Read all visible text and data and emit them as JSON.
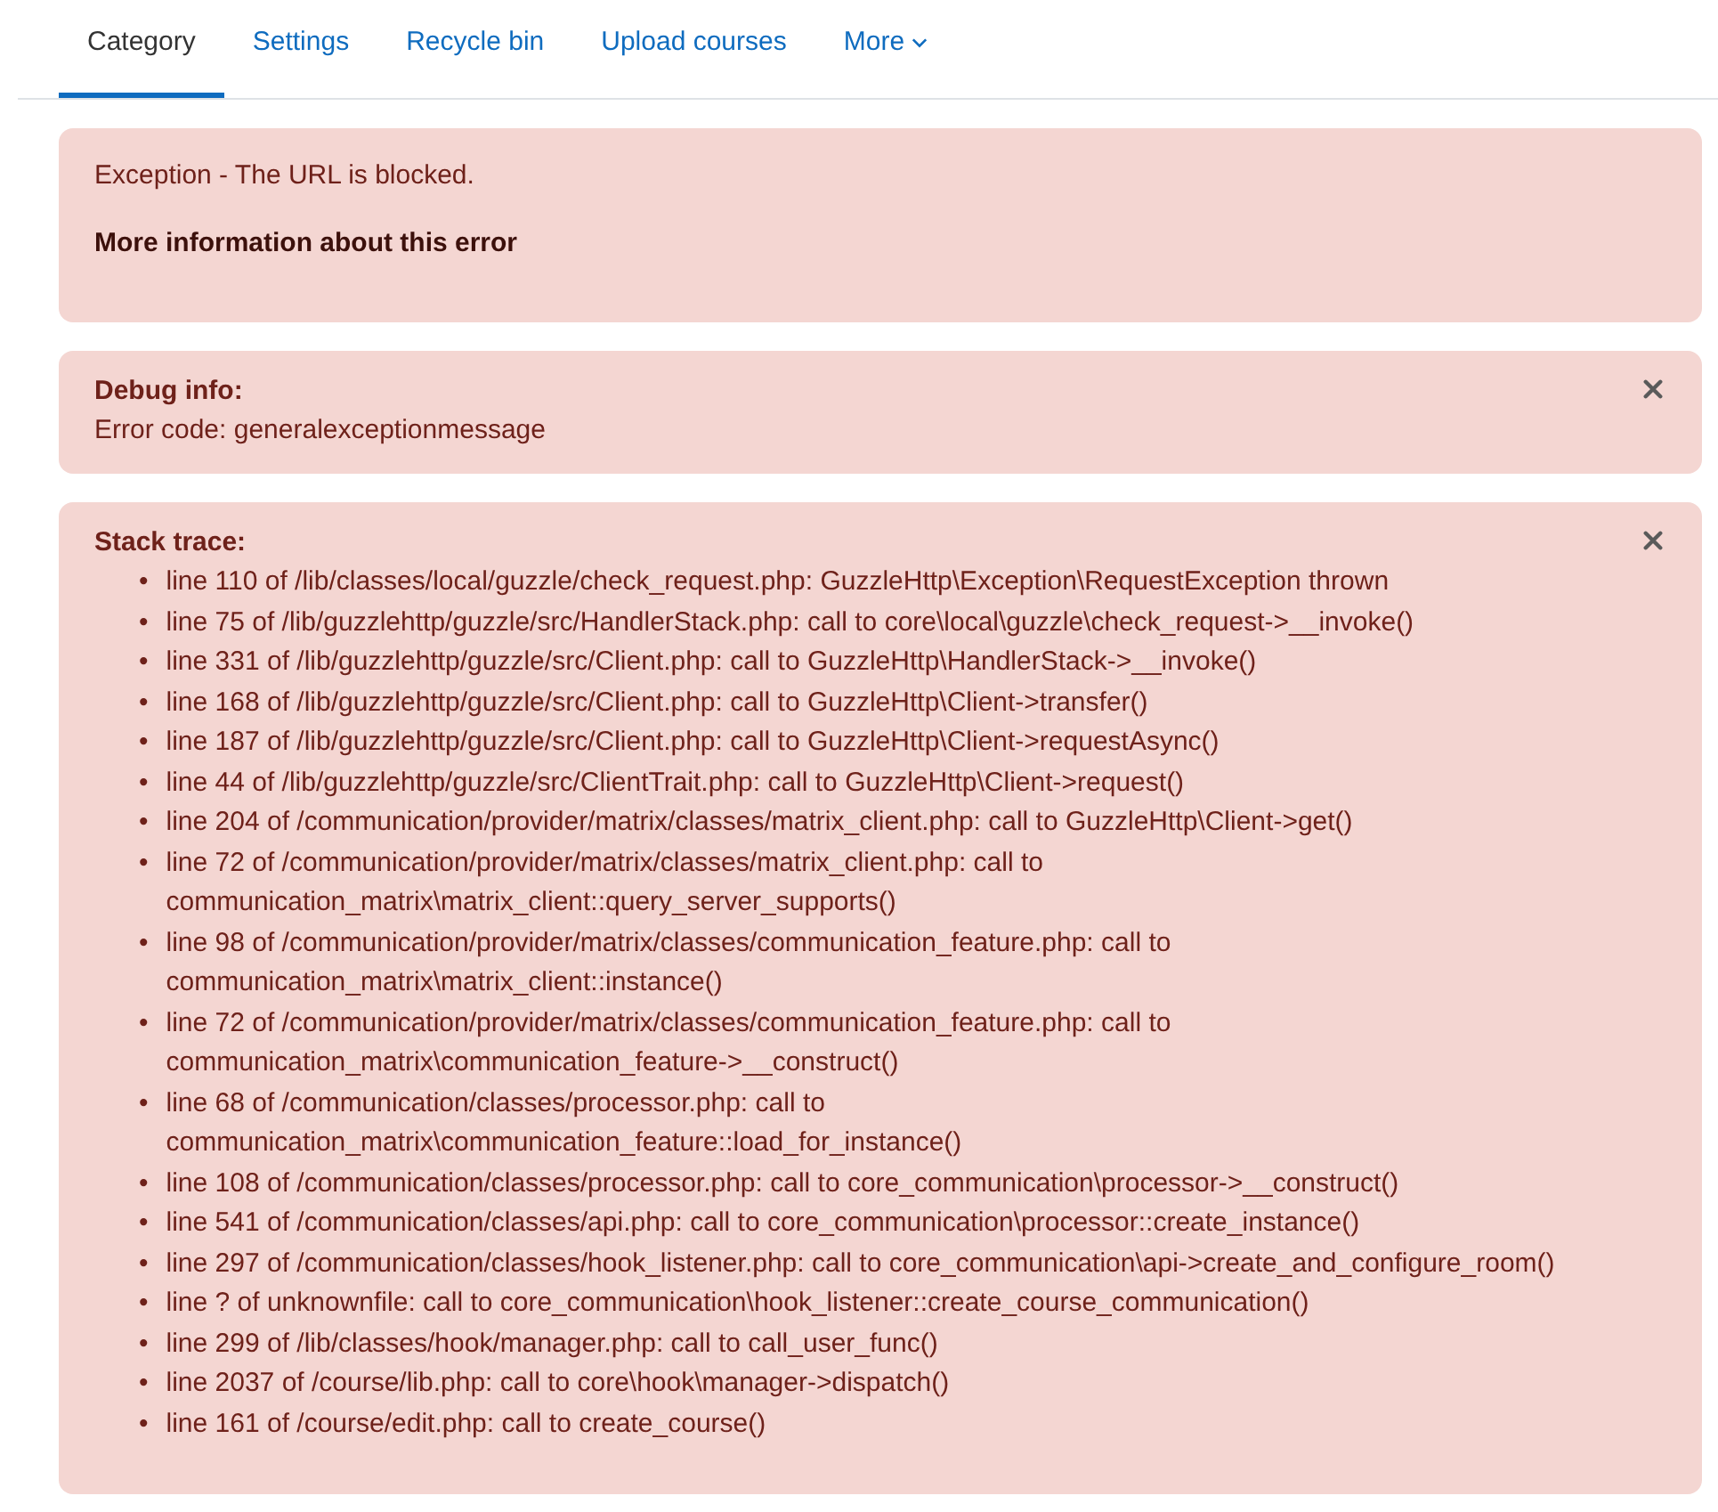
{
  "tabs": [
    {
      "label": "Category",
      "selected": true,
      "kind": "link"
    },
    {
      "label": "Settings",
      "selected": false,
      "kind": "link"
    },
    {
      "label": "Recycle bin",
      "selected": false,
      "kind": "link"
    },
    {
      "label": "Upload courses",
      "selected": false,
      "kind": "link"
    },
    {
      "label": "More",
      "selected": false,
      "kind": "dropdown"
    }
  ],
  "alerts": [
    {
      "kind": "message",
      "text": "Exception - The URL is blocked.",
      "link_text": "More information about this error",
      "dismissible": false
    },
    {
      "kind": "debug",
      "title": "Debug info:",
      "text": "Error code: generalexceptionmessage",
      "dismissible": true
    },
    {
      "kind": "trace",
      "title": "Stack trace:",
      "dismissible": true,
      "items": [
        {
          "bullet": "•",
          "text": "line 110 of /lib/classes/local/guzzle/check_request.php: GuzzleHttp\\Exception\\RequestException thrown"
        },
        {
          "bullet": "•",
          "text": "line 75 of /lib/guzzlehttp/guzzle/src/HandlerStack.php: call to core\\local\\guzzle\\check_request->__invoke()"
        },
        {
          "bullet": "•",
          "text": "line 331 of /lib/guzzlehttp/guzzle/src/Client.php: call to GuzzleHttp\\HandlerStack->__invoke()"
        },
        {
          "bullet": "•",
          "text": "line 168 of /lib/guzzlehttp/guzzle/src/Client.php: call to GuzzleHttp\\Client->transfer()"
        },
        {
          "bullet": "•",
          "text": "line 187 of /lib/guzzlehttp/guzzle/src/Client.php: call to GuzzleHttp\\Client->requestAsync()"
        },
        {
          "bullet": "•",
          "text": "line 44 of /lib/guzzlehttp/guzzle/src/ClientTrait.php: call to GuzzleHttp\\Client->request()"
        },
        {
          "bullet": "•",
          "text": "line 204 of /communication/provider/matrix/classes/matrix_client.php: call to GuzzleHttp\\Client->get()"
        },
        {
          "bullet": "•",
          "text": "line 72 of /communication/provider/matrix/classes/matrix_client.php: call to communication_matrix\\matrix_client::query_server_supports()"
        },
        {
          "bullet": "•",
          "text": "line 98 of /communication/provider/matrix/classes/communication_feature.php: call to communication_matrix\\matrix_client::instance()"
        },
        {
          "bullet": "•",
          "text": "line 72 of /communication/provider/matrix/classes/communication_feature.php: call to communication_matrix\\communication_feature->__construct()"
        },
        {
          "bullet": "•",
          "text": "line 68 of /communication/classes/processor.php: call to communication_matrix\\communication_feature::load_for_instance()"
        },
        {
          "bullet": "•",
          "text": "line 108 of /communication/classes/processor.php: call to core_communication\\processor->__construct()"
        },
        {
          "bullet": "•",
          "text": "line 541 of /communication/classes/api.php: call to core_communication\\processor::create_instance()"
        },
        {
          "bullet": "•",
          "text": "line 297 of /communication/classes/hook_listener.php: call to core_communication\\api->create_and_configure_room()"
        },
        {
          "bullet": "•",
          "text": "line ? of unknownfile: call to core_communication\\hook_listener::create_course_communication()"
        },
        {
          "bullet": "•",
          "text": "line 299 of /lib/classes/hook/manager.php: call to call_user_func()"
        },
        {
          "bullet": "•",
          "text": "line 2037 of /course/lib.php: call to core\\hook\\manager->dispatch()"
        },
        {
          "bullet": "•",
          "text": "line 161 of /course/edit.php: call to create_course()"
        }
      ]
    }
  ]
}
